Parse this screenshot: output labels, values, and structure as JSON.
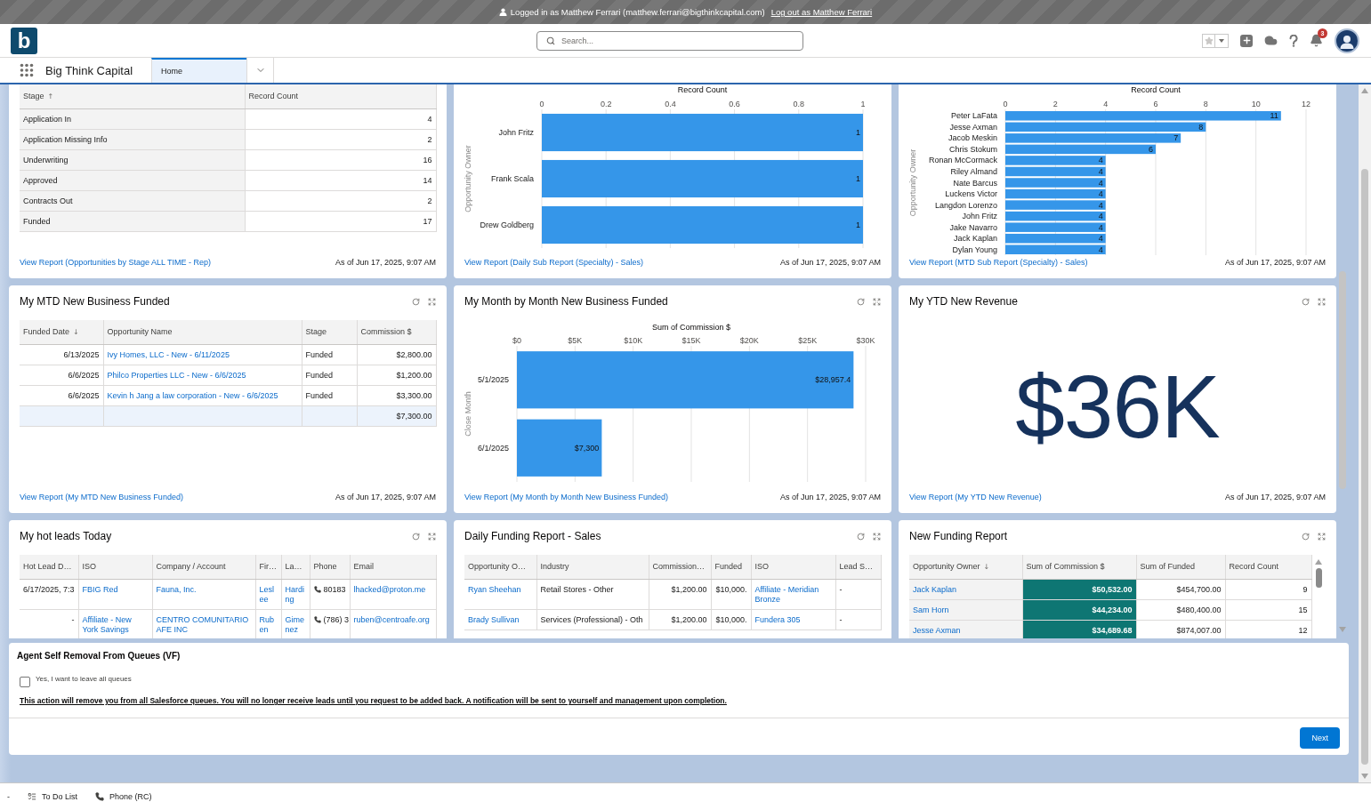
{
  "banner": {
    "text": "Logged in as Matthew Ferrari (matthew.ferrari@bigthinkcapital.com)",
    "link": "Log out as Matthew Ferrari"
  },
  "header": {
    "logo": "b",
    "search": {
      "placeholder": "Search..."
    },
    "notifications": "3"
  },
  "nav": {
    "app_name": "Big Think Capital",
    "tabs": [
      {
        "label": "Home",
        "selected": true
      }
    ]
  },
  "dashboard": {
    "cards": [
      {
        "kind": "table",
        "table": {
          "columns": [
            {
              "label": "Stage",
              "kind": "label",
              "sort_arrow": "↑"
            },
            {
              "label": "Record Count",
              "kind": "number"
            }
          ],
          "rows": [
            [
              "Application In",
              "4"
            ],
            [
              "Application Missing Info",
              "2"
            ],
            [
              "Underwriting",
              "16"
            ],
            [
              "Approved",
              "14"
            ],
            [
              "Contracts Out",
              "2"
            ],
            [
              "Funded",
              "17"
            ]
          ]
        },
        "report_link": "View Report (Opportunities by Stage ALL TIME - Rep)",
        "timestamp": "As of Jun 17, 2025, 9:07 AM"
      },
      {
        "kind": "chart",
        "chart_data": [
          {
            "type": "bar",
            "orientation": "horizontal",
            "xlabel": "Record Count",
            "ylabel": "Opportunity Owner",
            "categories": [
              "John Fritz",
              "Frank Scala",
              "Drew Goldberg"
            ],
            "values": [
              1,
              1,
              1
            ],
            "color": "#3596e9",
            "xlim": [
              0,
              1
            ],
            "xticks": [
              0,
              0.2,
              0.4,
              0.6,
              0.8,
              1
            ],
            "grid": true,
            "data_labels": true
          }
        ],
        "report_link": "View Report (Daily Sub Report (Specialty) - Sales)",
        "timestamp": "As of Jun 17, 2025, 9:07 AM"
      },
      {
        "kind": "chart",
        "chart_data": [
          {
            "type": "bar",
            "orientation": "horizontal",
            "xlabel": "Record Count",
            "ylabel": "Opportunity Owner",
            "categories": [
              "Peter LaFata",
              "Jesse Axman",
              "Jacob Meskin",
              "Chris Stokum",
              "Ronan McCormack",
              "Riley Almand",
              "Nate Barcus",
              "Luckens Victor",
              "Langdon Lorenzo",
              "John Fritz",
              "Jake Navarro",
              "Jack Kaplan",
              "Dylan Young"
            ],
            "values": [
              11,
              8,
              7,
              6,
              4,
              4,
              4,
              4,
              4,
              4,
              4,
              4,
              4
            ],
            "color": "#3596e9",
            "xlim": [
              0,
              12
            ],
            "xticks": [
              0,
              2,
              4,
              6,
              8,
              10,
              12
            ],
            "grid": true,
            "data_labels": true
          }
        ],
        "report_link": "View Report (MTD Sub Report (Specialty) - Sales)",
        "timestamp": "As of Jun 17, 2025, 9:07 AM"
      },
      {
        "kind": "table",
        "title": "My MTD New Business Funded",
        "table": {
          "columns": [
            {
              "label": "Funded Date",
              "kind": "number",
              "sort_arrow": "↓"
            },
            {
              "label": "Opportunity Name",
              "kind": "link"
            },
            {
              "label": "Stage",
              "kind": "text"
            },
            {
              "label": "Commission $",
              "kind": "number"
            }
          ],
          "rows": [
            [
              "6/13/2025",
              "Ivy Homes, LLC - New - 6/11/2025",
              "Funded",
              "$2,800.00"
            ],
            [
              "6/6/2025",
              "Philco Properties LLC - New - 6/6/2025",
              "Funded",
              "$1,200.00"
            ],
            [
              "6/6/2025",
              "Kevin h Jang a law corporation - New - 6/6/2025",
              "Funded",
              "$3,300.00"
            ]
          ],
          "total": "$7,300.00"
        },
        "report_link": "View Report (My MTD New Business Funded)",
        "timestamp": "As of Jun 17, 2025, 9:07 AM"
      },
      {
        "kind": "chart",
        "title": "My Month by Month New Business Funded",
        "chart_data": [
          {
            "type": "bar",
            "orientation": "horizontal",
            "xlabel": "Sum of Commission $",
            "ylabel": "Close Month",
            "categories": [
              "5/1/2025",
              "6/1/2025"
            ],
            "values": [
              28957.4,
              7300
            ],
            "color": "#3596e9",
            "xlim": [
              0,
              30000
            ],
            "xticks": [
              {
                "value": 0,
                "label": "$0"
              },
              {
                "value": 5000,
                "label": "$5K"
              },
              {
                "value": 10000,
                "label": "$10K"
              },
              {
                "value": 15000,
                "label": "$15K"
              },
              {
                "value": 20000,
                "label": "$20K"
              },
              {
                "value": 25000,
                "label": "$25K"
              },
              {
                "value": 30000,
                "label": "$30K"
              }
            ],
            "grid": true,
            "value_labels": [
              "$28,957.4",
              "$7,300"
            ]
          }
        ],
        "report_link": "View Report (My Month by Month New Business Funded)",
        "timestamp": "As of Jun 17, 2025, 9:07 AM"
      },
      {
        "kind": "metric",
        "title": "My YTD New Revenue",
        "value": "$36K",
        "report_link": "View Report (My YTD New Revenue)",
        "timestamp": "As of Jun 17, 2025, 9:07 AM"
      },
      {
        "kind": "table",
        "title": "My hot leads Today",
        "table": {
          "columns": [
            {
              "label": "Hot Lead D…",
              "kind": "number"
            },
            {
              "label": "ISO",
              "kind": "link"
            },
            {
              "label": "Company / Account",
              "kind": "link"
            },
            {
              "label": "Fir…",
              "kind": "link"
            },
            {
              "label": "La…",
              "kind": "link"
            },
            {
              "label": "Phone",
              "kind": "phone"
            },
            {
              "label": "Email",
              "kind": "link"
            }
          ],
          "rows": [
            [
              "6/17/2025, 7:3",
              "FBIG Red",
              "Fauna, Inc.",
              "Leslee",
              "Harding",
              "80183",
              "lhacked@proton.me"
            ],
            [
              "-",
              "Affiliate - New York Savings",
              "CENTRO COMUNITARIO AFE INC",
              "Ruben",
              "Gimenez",
              "(786) 3",
              "ruben@centroafe.org"
            ]
          ]
        }
      },
      {
        "kind": "table",
        "title": "Daily Funding Report - Sales",
        "table": {
          "columns": [
            {
              "label": "Opportunity O…",
              "kind": "link"
            },
            {
              "label": "Industry",
              "kind": "text"
            },
            {
              "label": "Commission…",
              "kind": "number"
            },
            {
              "label": "Funded",
              "kind": "number"
            },
            {
              "label": "ISO",
              "kind": "link"
            },
            {
              "label": "Lead S…",
              "kind": "text"
            }
          ],
          "rows": [
            [
              "Ryan Sheehan",
              "Retail Stores - Other",
              "$1,200.00",
              "$10,000.",
              "Affiliate - Meridian Bronze",
              "-"
            ],
            [
              "Brady Sullivan",
              "Services (Professional) - Oth",
              "$1,200.00",
              "$10,000.",
              "Fundera 305",
              "-"
            ]
          ]
        }
      },
      {
        "kind": "table",
        "title": "New Funding Report",
        "table": {
          "columns": [
            {
              "label": "Opportunity Owner",
              "kind": "group",
              "sort_arrow": "↓"
            },
            {
              "label": "Sum of Commission $",
              "kind": "highlight"
            },
            {
              "label": "Sum of Funded",
              "kind": "number"
            },
            {
              "label": "Record Count",
              "kind": "number"
            }
          ],
          "rows": [
            [
              "Jack Kaplan",
              "$50,532.00",
              "$454,700.00",
              "9"
            ],
            [
              "Sam Horn",
              "$44,234.00",
              "$480,400.00",
              "15"
            ],
            [
              "Jesse Axman",
              "$34,689.68",
              "$874,007.00",
              "12"
            ]
          ]
        }
      }
    ]
  },
  "agent_removal": {
    "title": "Agent Self Removal From Queues (VF)",
    "checkbox": {
      "label": "Yes, I want to leave all queues",
      "checked": false
    },
    "notice": "This action will remove you from all Salesforce queues. You will no longer receive leads until you request to be added back. A notification will be sent to yourself and management upon completion.",
    "button": "Next"
  },
  "utility_bar": [
    {
      "kind": "plain",
      "label": "-"
    },
    {
      "kind": "list",
      "label": "To Do List"
    },
    {
      "kind": "phone",
      "label": "Phone (RC)"
    }
  ]
}
